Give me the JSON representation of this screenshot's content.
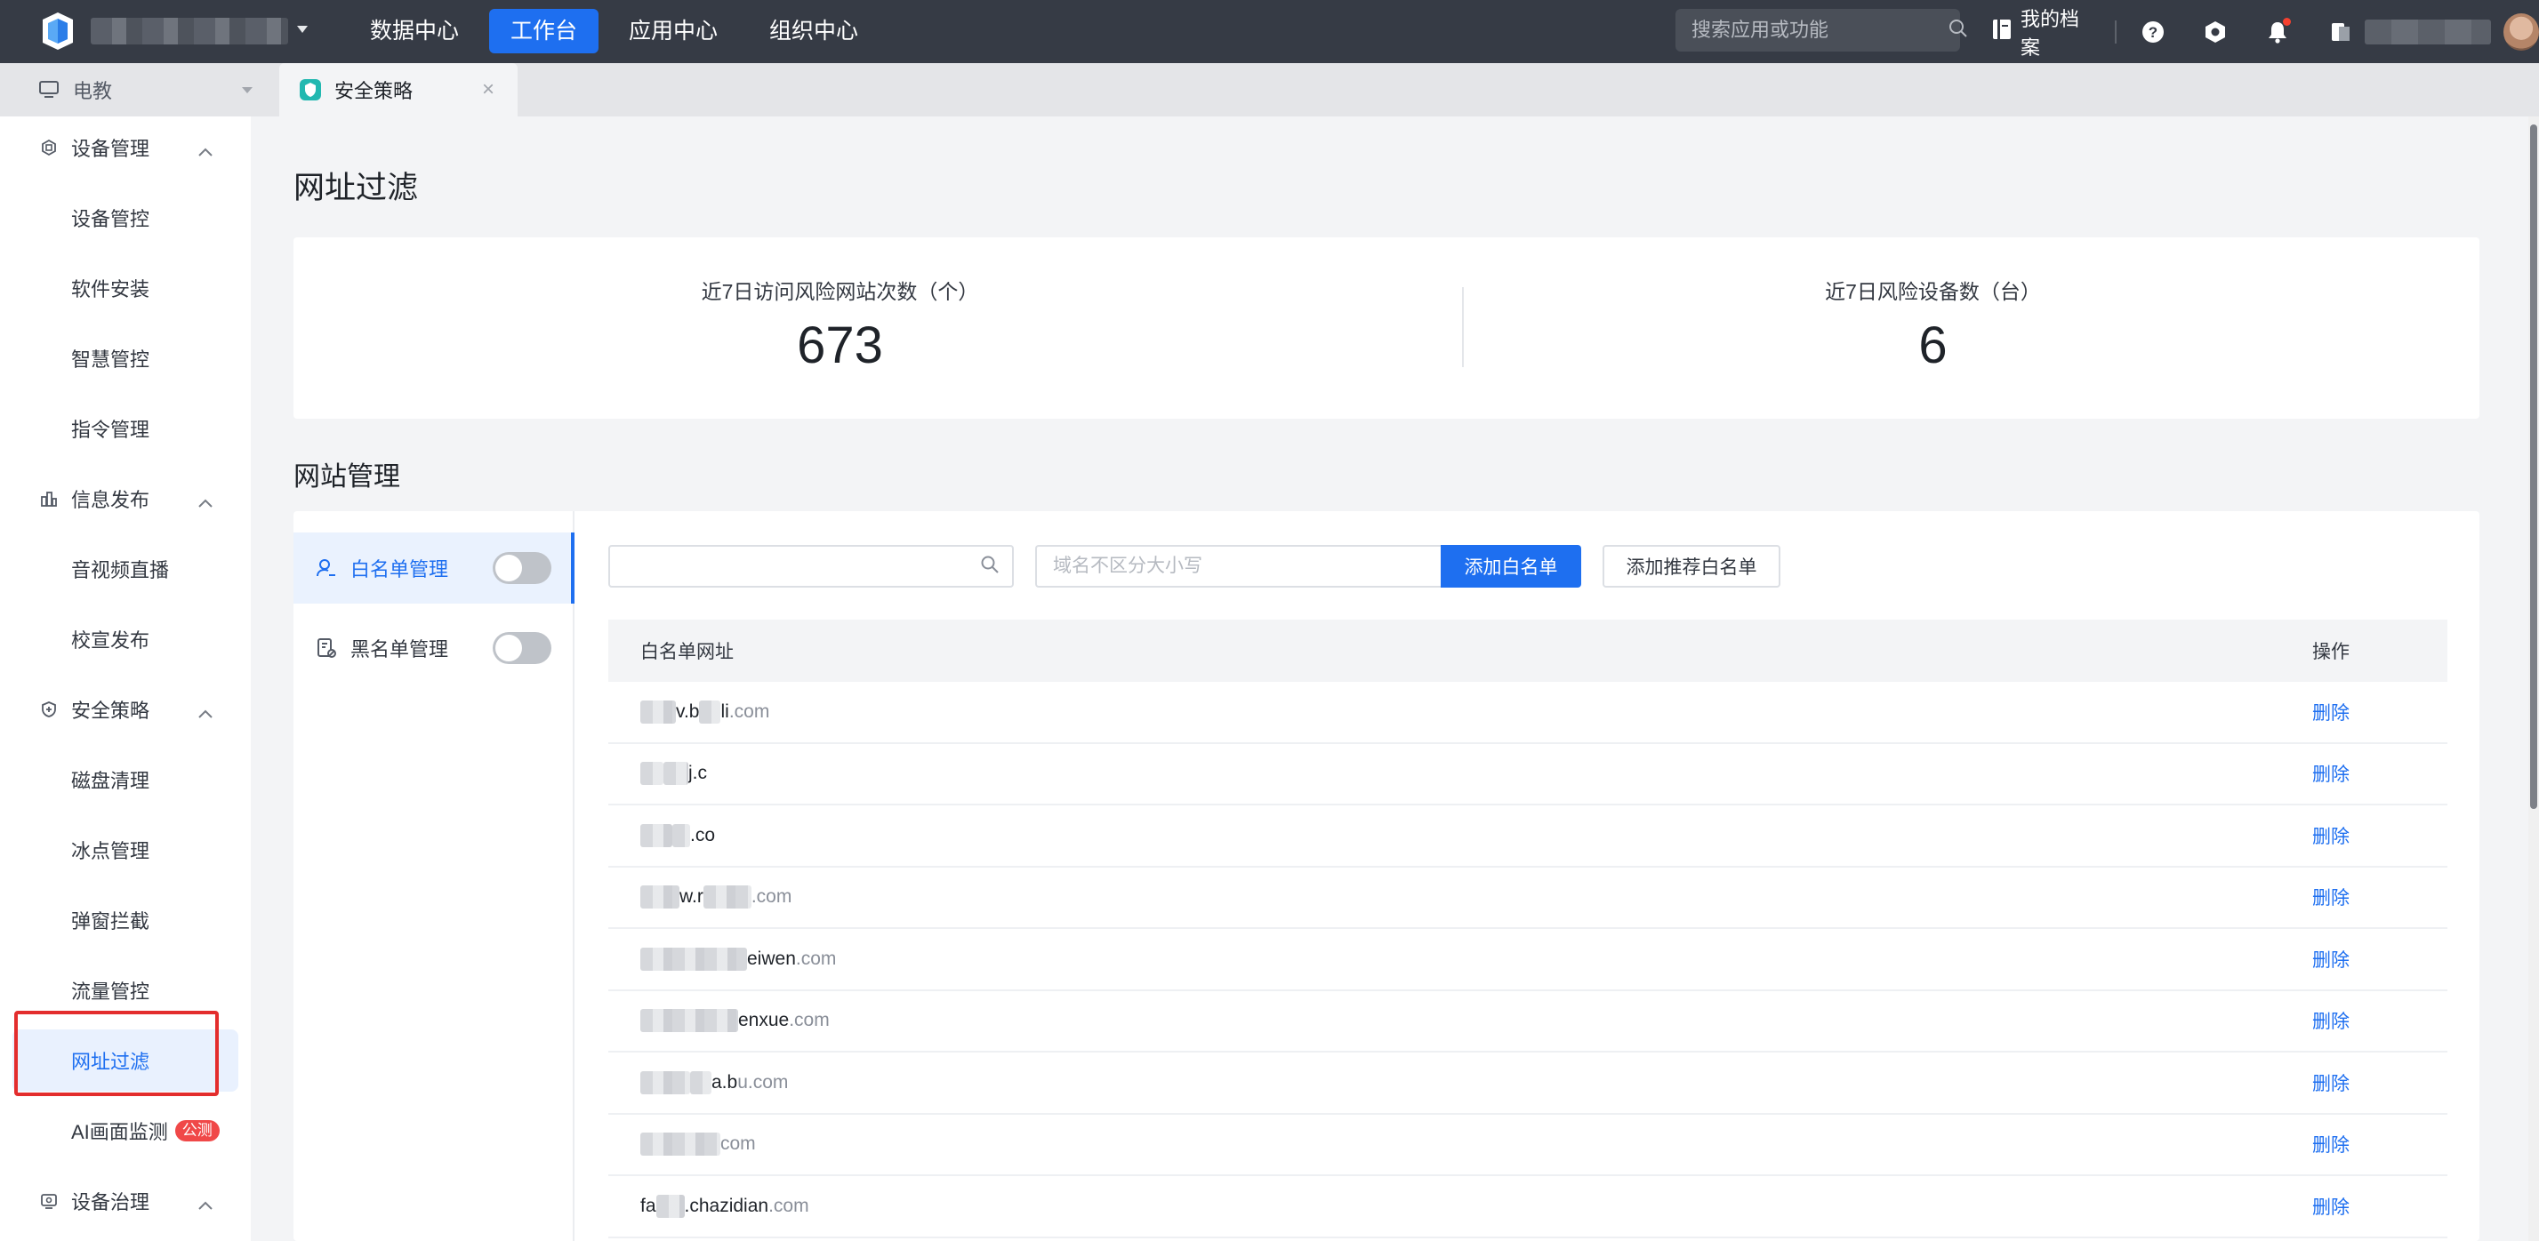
{
  "topnav": {
    "menu": [
      {
        "label": "数据中心",
        "active": false
      },
      {
        "label": "工作台",
        "active": true
      },
      {
        "label": "应用中心",
        "active": false
      },
      {
        "label": "组织中心",
        "active": false
      }
    ],
    "search_placeholder": "搜索应用或功能",
    "profile_label": "我的档案",
    "brand_color": "#1e6ff0"
  },
  "tabs": {
    "workspace_label": "电教",
    "current_tab_label": "安全策略"
  },
  "sidebar": {
    "groups": [
      {
        "label": "设备管理",
        "icon": "device-icon",
        "items": [
          "设备管控",
          "软件安装",
          "智慧管控",
          "指令管理"
        ]
      },
      {
        "label": "信息发布",
        "icon": "publish-icon",
        "items": [
          "音视频直播",
          "校宣发布"
        ]
      },
      {
        "label": "安全策略",
        "icon": "shield-icon",
        "items": [
          "磁盘清理",
          "冰点管理",
          "弹窗拦截",
          "流量管控",
          "网址过滤",
          "AI画面监测"
        ]
      },
      {
        "label": "设备治理",
        "icon": "governance-icon",
        "items": []
      }
    ],
    "active_item": "网址过滤",
    "badge": "公测"
  },
  "main": {
    "page_title": "网址过滤",
    "stats": [
      {
        "label": "近7日访问风险网站次数（个）",
        "value": "673"
      },
      {
        "label": "近7日风险设备数（台）",
        "value": "6"
      }
    ],
    "section_title": "网站管理",
    "list_nav": [
      {
        "label": "白名单管理",
        "enabled": false,
        "active": true
      },
      {
        "label": "黑名单管理",
        "enabled": false,
        "active": false
      }
    ],
    "domain_placeholder": "域名不区分大小写",
    "add_whitelist_label": "添加白名单",
    "add_recommended_label": "添加推荐白名单",
    "table": {
      "col_url": "白名单网址",
      "col_op": "操作",
      "rows": [
        {
          "visible": "v.b",
          "mid": "li",
          "suffix": ".com",
          "blur1": 40,
          "blur2": 24
        },
        {
          "visible": "",
          "mid": "j.c",
          "suffix": "",
          "blur1": 26,
          "blur2": 28
        },
        {
          "visible": "",
          "mid": ".co",
          "suffix": "",
          "blur1": 36,
          "blur2": 20
        },
        {
          "visible": "w.r",
          "mid": "",
          "suffix": ".com",
          "blur1": 44,
          "blur2": 54
        },
        {
          "visible": "",
          "mid": "eiwen",
          "suffix": ".com",
          "blur1": 120,
          "blur2": 0
        },
        {
          "visible": "",
          "mid": "enxue",
          "suffix": ".com",
          "blur1": 110,
          "blur2": 0
        },
        {
          "visible": "",
          "mid": "a.b",
          "suffix": "u.com",
          "blur1": 56,
          "blur2": 24
        },
        {
          "visible": "",
          "mid": "",
          "suffix": "com",
          "blur1": 90,
          "blur2": 0
        },
        {
          "visible": "fa",
          "mid": ".chazidian",
          "suffix": ".com",
          "blur1": 0,
          "blur2": 32
        }
      ],
      "delete_label": "删除"
    }
  }
}
